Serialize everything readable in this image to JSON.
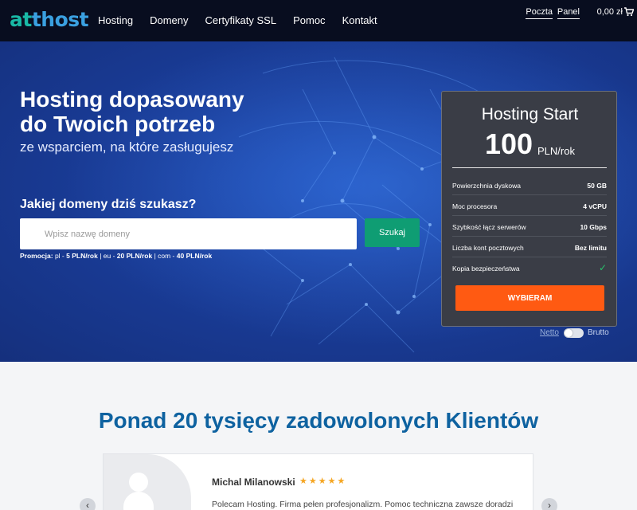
{
  "logo": {
    "part1": "at",
    "part2": "thost"
  },
  "nav": {
    "items": [
      "Hosting",
      "Domeny",
      "Certyfikaty SSL",
      "Pomoc",
      "Kontakt"
    ],
    "poczta": "Poczta",
    "panel": "Panel",
    "cart": "0,00 zł"
  },
  "hero": {
    "title_line1": "Hosting dopasowany",
    "title_line2": "do Twoich potrzeb",
    "subtitle": "ze wsparciem, na które zasługujesz",
    "question": "Jakiej domeny dziś szukasz?",
    "search_placeholder": "Wpisz nazwę domeny",
    "search_button": "Szukaj",
    "promo": {
      "label": "Promocja:",
      "pl_prefix": "pl -",
      "pl_price": "5 PLN/rok",
      "eu_prefix": "eu -",
      "eu_price": "20 PLN/rok",
      "com_prefix": "com -",
      "com_price": "40 PLN/rok"
    }
  },
  "plan": {
    "name": "Hosting Start",
    "price": "100",
    "period": "PLN/rok",
    "features": [
      {
        "label": "Powierzchnia dyskowa",
        "value": "50 GB"
      },
      {
        "label": "Moc procesora",
        "value": "4 vCPU"
      },
      {
        "label": "Szybkość łącz serwerów",
        "value": "10 Gbps"
      },
      {
        "label": "Liczba kont pocztowych",
        "value": "Bez limitu"
      },
      {
        "label": "Kopia bezpieczeństwa",
        "value": "✓"
      }
    ],
    "button": "WYBIERAM",
    "toggle_left": "Netto",
    "toggle_right": "Brutto"
  },
  "clients": {
    "title": "Ponad 20 tysięcy zadowolonych Klientów",
    "testimonial": {
      "name": "Michal Milanowski",
      "rating": 5,
      "stars": "★★★★★",
      "text": "Polecam Hosting. Firma pełen profesjonalizm. Pomoc techniczna zawsze doradzi"
    }
  },
  "colors": {
    "accent_green": "#0f9d73",
    "accent_orange": "#ff5a12",
    "brand_blue": "#0e62a0"
  }
}
